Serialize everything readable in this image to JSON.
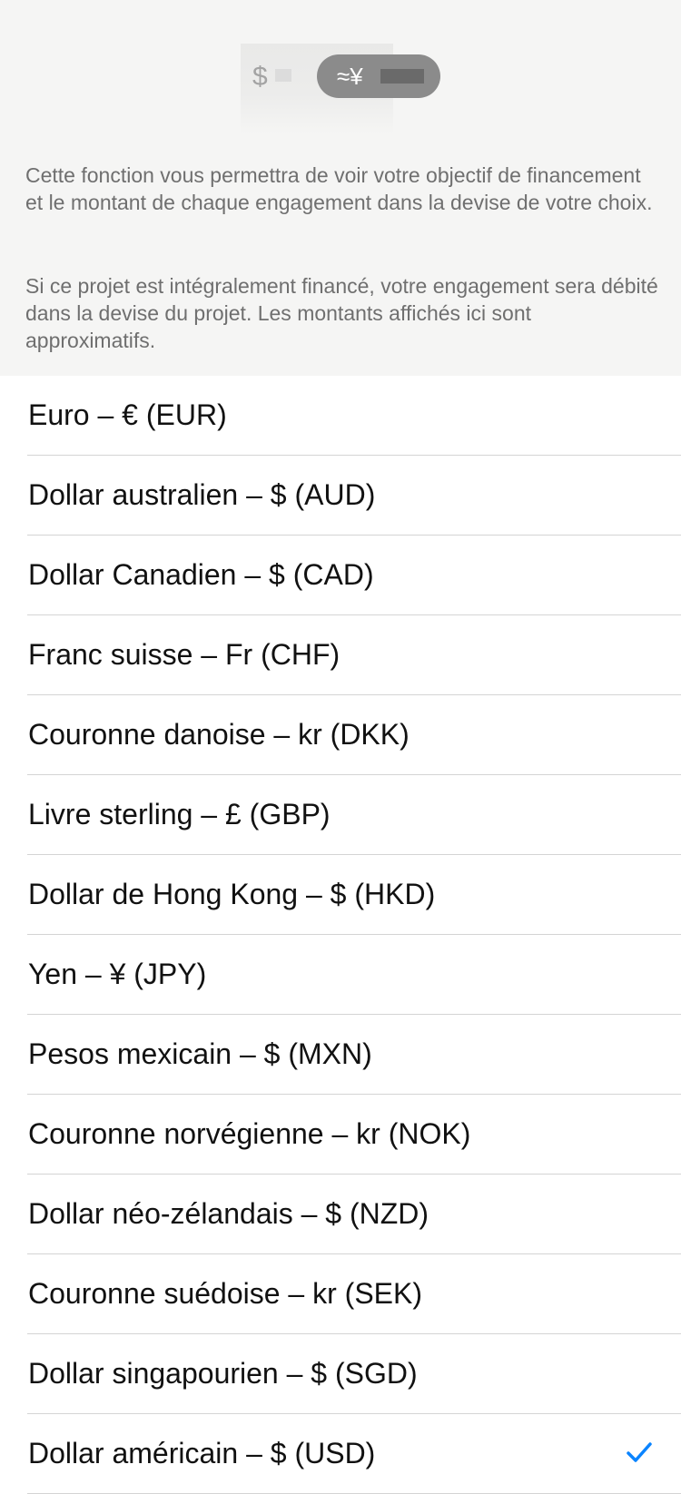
{
  "illustration": {
    "base_symbol": "$",
    "converted_symbol": "≈¥"
  },
  "description": {
    "paragraph1": "Cette fonction vous permettra de voir votre objectif de financement et le montant de chaque engagement dans la devise de votre choix.",
    "paragraph2": "Si ce projet est intégralement financé, votre engagement sera débité dans la devise du projet. Les montants affichés ici sont approximatifs."
  },
  "currencies": [
    {
      "label": "Euro – € (EUR)",
      "selected": false
    },
    {
      "label": "Dollar australien – $ (AUD)",
      "selected": false
    },
    {
      "label": "Dollar Canadien – $ (CAD)",
      "selected": false
    },
    {
      "label": "Franc suisse – Fr (CHF)",
      "selected": false
    },
    {
      "label": "Couronne danoise – kr (DKK)",
      "selected": false
    },
    {
      "label": "Livre sterling – £ (GBP)",
      "selected": false
    },
    {
      "label": "Dollar de Hong Kong – $ (HKD)",
      "selected": false
    },
    {
      "label": "Yen – ¥ (JPY)",
      "selected": false
    },
    {
      "label": "Pesos mexicain – $ (MXN)",
      "selected": false
    },
    {
      "label": "Couronne norvégienne – kr (NOK)",
      "selected": false
    },
    {
      "label": "Dollar néo-zélandais – $ (NZD)",
      "selected": false
    },
    {
      "label": "Couronne suédoise – kr (SEK)",
      "selected": false
    },
    {
      "label": "Dollar singapourien – $ (SGD)",
      "selected": false
    },
    {
      "label": "Dollar américain – $ (USD)",
      "selected": true
    }
  ],
  "colors": {
    "header_background": "#f5f5f4",
    "checkmark": "#0a84ff",
    "description_text": "#6f6f6f"
  },
  "icons": {
    "selected_marker": "checkmark-icon"
  }
}
